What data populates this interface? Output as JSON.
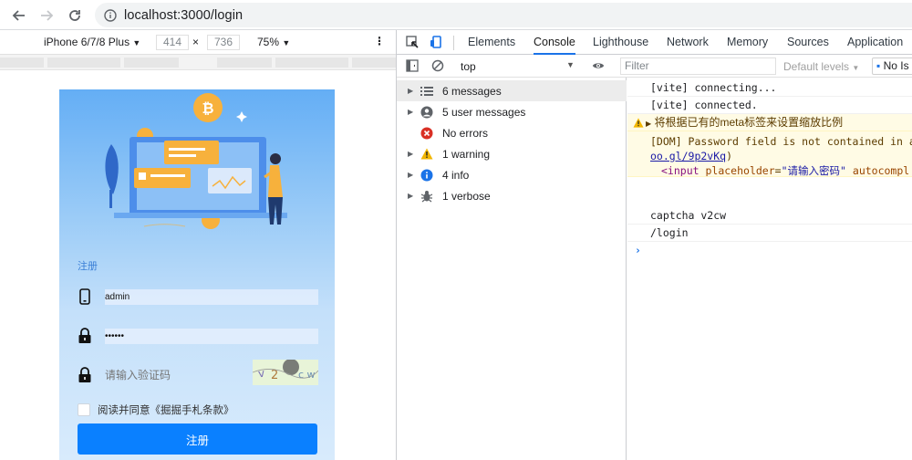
{
  "browser": {
    "url": "localhost:3000/login"
  },
  "device_toolbar": {
    "device": "iPhone 6/7/8 Plus",
    "width": "414",
    "times": "×",
    "height": "736",
    "zoom": "75%"
  },
  "app": {
    "register_link": "注册",
    "username_value": "admin",
    "password_value": "••••••",
    "captcha_placeholder": "请输入验证码",
    "agree_text": "阅读并同意《掘掘手札条款》",
    "submit_label": "注册",
    "colors": {
      "primary": "#0a80ff",
      "link": "#3a7fd6"
    }
  },
  "devtools": {
    "tabs": [
      "Elements",
      "Console",
      "Lighthouse",
      "Network",
      "Memory",
      "Sources",
      "Application"
    ],
    "active_tab": "Console",
    "context": "top",
    "filter_placeholder": "Filter",
    "levels": "Default levels",
    "issues": "No Is",
    "sidebar": [
      {
        "label": "6 messages",
        "icon": "list-icon"
      },
      {
        "label": "5 user messages",
        "icon": "user-icon"
      },
      {
        "label": "No errors",
        "icon": "error-icon"
      },
      {
        "label": "1 warning",
        "icon": "warning-icon"
      },
      {
        "label": "4 info",
        "icon": "info-icon"
      },
      {
        "label": "1 verbose",
        "icon": "bug-icon"
      }
    ],
    "log": {
      "l1": "[vite] connecting...",
      "l2": "[vite] connected.",
      "warn": "将根据已有的meta标签来设置缩放比例",
      "dom1": "[DOM] Password field is not contained in a",
      "dom_link": "oo.gl/9p2vKq",
      "dom_close": ")",
      "dom_tag_open": "<input",
      "dom_attr": "placeholder",
      "dom_eq": "=",
      "dom_val": "\"请输入密码\"",
      "dom_rest": "autocompl",
      "captcha": "captcha v2cw",
      "route": "/login",
      "prompt": "›"
    }
  }
}
